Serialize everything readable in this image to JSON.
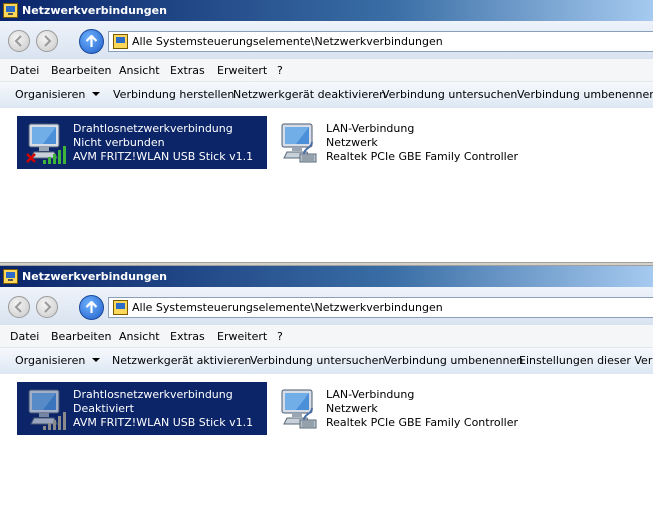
{
  "top": {
    "window_title": "Netzwerkverbindungen",
    "address": "Alle Systemsteuerungselemente\\Netzwerkverbindungen",
    "menu": [
      "Datei",
      "Bearbeiten",
      "Ansicht",
      "Extras",
      "Erweitert",
      "?"
    ],
    "commands": [
      "Organisieren",
      "Verbindung herstellen",
      "Netzwerkgerät deaktivieren",
      "Verbindung untersuchen",
      "Verbindung umbenennen"
    ],
    "connections": [
      {
        "name": "Drahtlosnetzwerkverbindung",
        "status": "Nicht verbunden",
        "device": "AVM FRITZ!WLAN USB Stick v1.1",
        "icon": "wireless-disconnected-icon",
        "selected": true
      },
      {
        "name": "LAN-Verbindung",
        "status": "Netzwerk",
        "device": "Realtek PCIe GBE Family Controller",
        "icon": "lan-network-icon",
        "selected": false
      }
    ]
  },
  "bottom": {
    "window_title": "Netzwerkverbindungen",
    "address": "Alle Systemsteuerungselemente\\Netzwerkverbindungen",
    "menu": [
      "Datei",
      "Bearbeiten",
      "Ansicht",
      "Extras",
      "Erweitert",
      "?"
    ],
    "commands": [
      "Organisieren",
      "Netzwerkgerät aktivieren",
      "Verbindung untersuchen",
      "Verbindung umbenennen",
      "Einstellungen dieser Verbind"
    ],
    "connections": [
      {
        "name": "Drahtlosnetzwerkverbindung",
        "status": "Deaktiviert",
        "device": "AVM FRITZ!WLAN USB Stick v1.1",
        "icon": "wireless-disabled-icon",
        "selected": true
      },
      {
        "name": "LAN-Verbindung",
        "status": "Netzwerk",
        "device": "Realtek PCIe GBE Family Controller",
        "icon": "lan-network-icon",
        "selected": false
      }
    ]
  },
  "colors": {
    "selection": "#0c2568",
    "titlebar_start": "#0a246a",
    "titlebar_end": "#a6caf0",
    "disconnect_x": "#d40000",
    "signal_on": "#3cb43c"
  }
}
